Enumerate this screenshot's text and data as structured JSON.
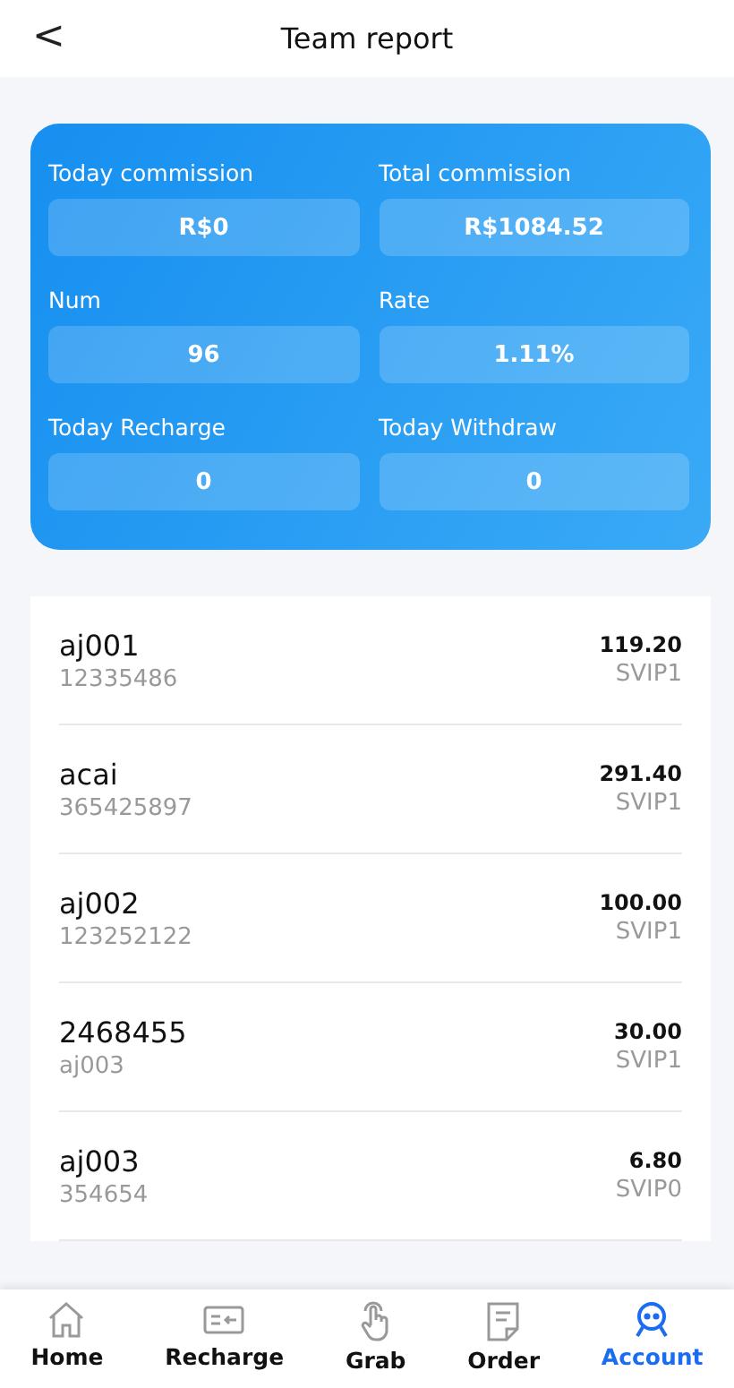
{
  "header": {
    "back": "<",
    "title": "Team report"
  },
  "stats": [
    {
      "label": "Today commission",
      "value": "R$0"
    },
    {
      "label": "Total commission",
      "value": "R$1084.52"
    },
    {
      "label": "Num",
      "value": "96"
    },
    {
      "label": "Rate",
      "value": "1.11%"
    },
    {
      "label": "Today Recharge",
      "value": "0"
    },
    {
      "label": "Today Withdraw",
      "value": "0"
    }
  ],
  "members": [
    {
      "name": "aj001",
      "sub": "12335486",
      "amount": "119.20",
      "level": "SVIP1"
    },
    {
      "name": "acai",
      "sub": "365425897",
      "amount": "291.40",
      "level": "SVIP1"
    },
    {
      "name": "aj002",
      "sub": "123252122",
      "amount": "100.00",
      "level": "SVIP1"
    },
    {
      "name": "2468455",
      "sub": "aj003",
      "amount": "30.00",
      "level": "SVIP1"
    },
    {
      "name": "aj003",
      "sub": "354654",
      "amount": "6.80",
      "level": "SVIP0"
    }
  ],
  "nav": [
    {
      "label": "Home",
      "kind": "home",
      "selected": false
    },
    {
      "label": "Recharge",
      "kind": "recharge",
      "selected": false
    },
    {
      "label": "Grab",
      "kind": "grab",
      "selected": false
    },
    {
      "label": "Order",
      "kind": "order",
      "selected": false
    },
    {
      "label": "Account",
      "kind": "account",
      "selected": true
    }
  ]
}
